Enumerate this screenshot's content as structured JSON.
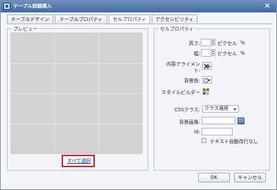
{
  "window": {
    "title": "テーブル詳細挿入",
    "close_glyph": "✕"
  },
  "tabs": [
    {
      "label": "テーブルデザイン"
    },
    {
      "label": "テーブルプロパティ"
    },
    {
      "label": "セルプロパティ"
    },
    {
      "label": "アクセシビリティ"
    }
  ],
  "active_tab": "セルプロパティ",
  "preview": {
    "title": "プレビュー",
    "select_all_label": "すべて選択",
    "grid_rows": 4,
    "grid_cols": 3
  },
  "cell_properties": {
    "title": "セルプロパティ",
    "height": {
      "label": "高さ:",
      "value": "",
      "unit_pixel": "ピクセル",
      "unit_percent": "%"
    },
    "width": {
      "label": "幅:",
      "value": "",
      "unit_pixel": "ピクセル",
      "unit_percent": "%"
    },
    "alignment": {
      "label_line1": "内容アライメン",
      "label_line2": "ト:",
      "icon": "alignment-icon"
    },
    "background_color": {
      "label": "背景色:",
      "icon": "color-picker-icon"
    },
    "style_builder": {
      "label": "スタイルビルダー",
      "icon": "style-builder-icon"
    },
    "css_class": {
      "label": "CSSクラス:",
      "selected": "クラス適用"
    },
    "background_image": {
      "label": "背景画像:",
      "value": ""
    },
    "id": {
      "label": "Id:",
      "value": ""
    },
    "no_wrap": {
      "label": "テキスト自動改行なし",
      "checked": false
    }
  },
  "buttons": {
    "ok": "OK",
    "cancel": "キャンセル"
  },
  "colors": {
    "title_bar": "#3d6aa6",
    "highlight": "#d42020",
    "link": "#1b3fa0"
  }
}
